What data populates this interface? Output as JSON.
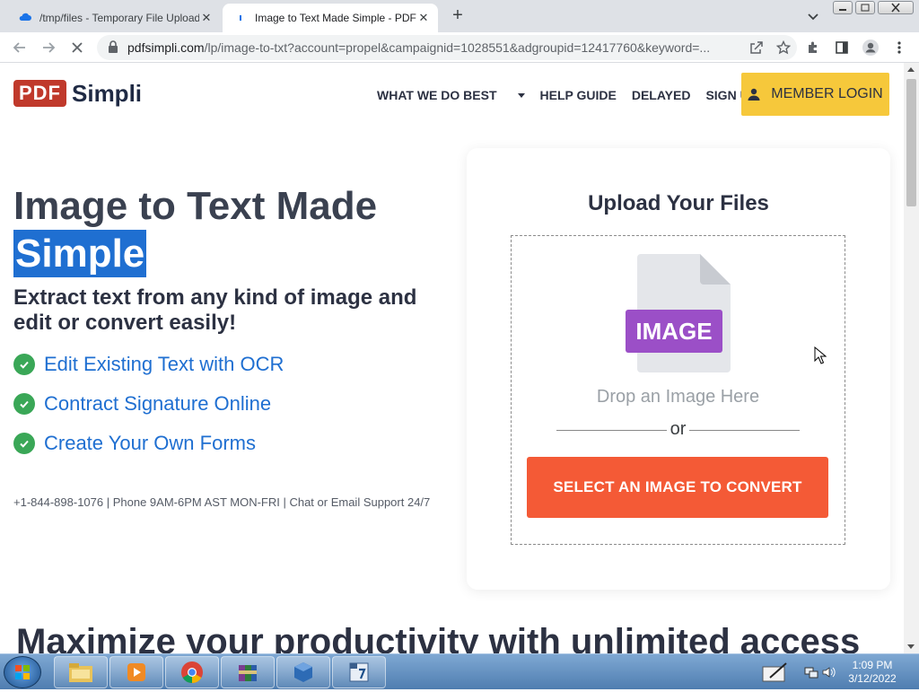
{
  "browser": {
    "tabs": [
      {
        "title": "/tmp/files - Temporary File Upload",
        "active": false
      },
      {
        "title": "Image to Text Made Simple - PDFSimpli",
        "active": true
      }
    ],
    "url_host": "pdfsimpli.com",
    "url_path": "/lp/image-to-txt?account=propel&campaignid=1028551&adgroupid=12417760&keyword=..."
  },
  "site": {
    "logo_pdf": "PDF",
    "logo_simpli": "Simpli",
    "nav": [
      "WHAT WE DO BEST",
      "HELP GUIDE",
      "DELAYED",
      "SIGN UP"
    ],
    "member_login": "MEMBER LOGIN"
  },
  "hero": {
    "title": "Image to Text Made",
    "highlight": "Simple",
    "subtitle": "Extract text from any kind of image and edit or convert easily!",
    "features": [
      "Edit Existing Text with OCR",
      "Contract Signature Online",
      "Create Your Own Forms"
    ],
    "support": "+1-844-898-1076 | Phone 9AM-6PM AST MON-FRI | Chat or Email Support 24/7"
  },
  "upload": {
    "title": "Upload Your Files",
    "file_badge": "IMAGE",
    "drop_text": "Drop an Image Here",
    "or_text": "or",
    "button": "SELECT AN IMAGE TO CONVERT"
  },
  "bottom": {
    "heading": "Maximize your productivity with unlimited access"
  },
  "taskbar": {
    "time": "1:09 PM",
    "date": "3/12/2022"
  },
  "colors": {
    "accent_blue": "#1f6fd1",
    "cta_orange": "#f45a36",
    "login_yellow": "#f6c83b",
    "logo_red": "#c0392b",
    "check_green": "#3aa757",
    "badge_purple": "#9b4fc7"
  }
}
